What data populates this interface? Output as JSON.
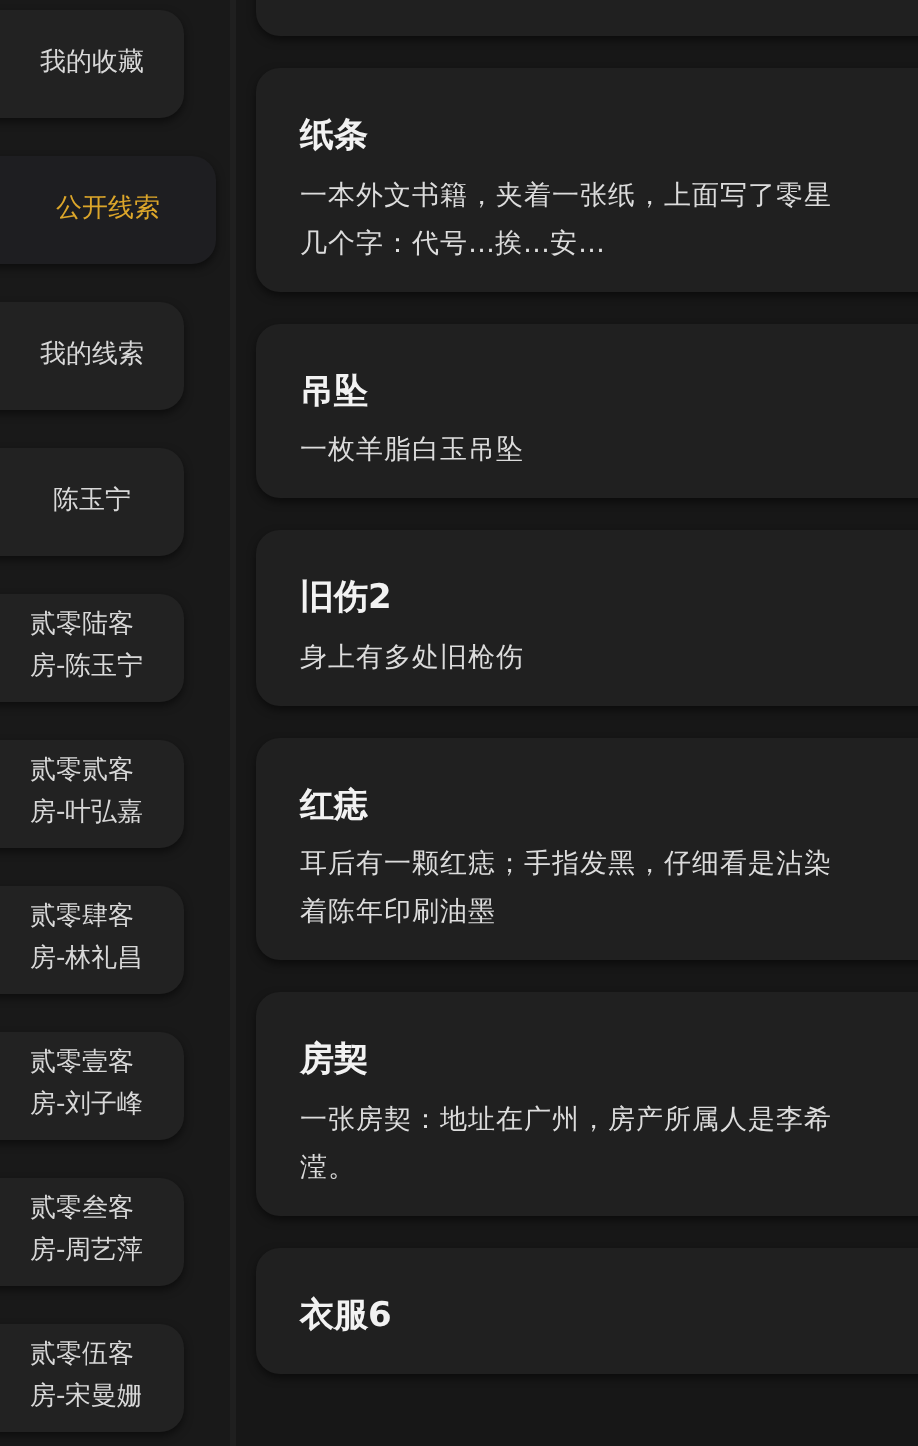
{
  "sidebar": {
    "items": [
      {
        "label": "我的收藏",
        "selected": false
      },
      {
        "label": "公开线索",
        "selected": true
      },
      {
        "label": "我的线索",
        "selected": false
      },
      {
        "label": "陈玉宁",
        "selected": false
      },
      {
        "label": "贰零陆客房-陈玉宁",
        "selected": false
      },
      {
        "label": "贰零贰客房-叶弘嘉",
        "selected": false
      },
      {
        "label": "贰零肆客房-林礼昌",
        "selected": false
      },
      {
        "label": "贰零壹客房-刘子峰",
        "selected": false
      },
      {
        "label": "贰零叁客房-周艺萍",
        "selected": false
      },
      {
        "label": "贰零伍客房-宋曼姗",
        "selected": false
      }
    ]
  },
  "clues": [
    {
      "title": "纸条",
      "description": "一本外文书籍，夹着一张纸，上面写了零星几个字：代号…挨…安…"
    },
    {
      "title": "吊坠",
      "description": "一枚羊脂白玉吊坠"
    },
    {
      "title": "旧伤2",
      "description": "身上有多处旧枪伤"
    },
    {
      "title": "红痣",
      "description": "耳后有一颗红痣；手指发黑，仔细看是沾染着陈年印刷油墨"
    },
    {
      "title": "房契",
      "description": "一张房契：地址在广州，房产所属人是李希滢。"
    },
    {
      "title": "衣服6"
    }
  ]
}
